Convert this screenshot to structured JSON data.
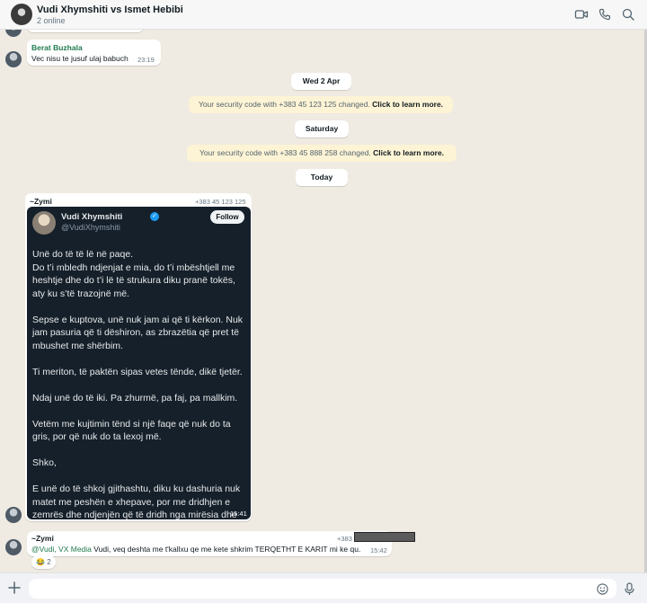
{
  "header": {
    "title": "Vudi Xhymshiti vs Ismet Hebibi",
    "subtitle": "2 online",
    "icons": [
      "video-call-icon",
      "voice-call-icon",
      "search-icon"
    ]
  },
  "messages": {
    "m1": {
      "sender": "Berat Buzhala",
      "sender_color": "#1f7a4d",
      "text": "Vec nisu te jusuf ulaj babuch",
      "time": "23:19"
    },
    "dates": {
      "d1": "Wed 2 Apr",
      "d2": "Saturday",
      "d3": "Today"
    },
    "sys1": {
      "prefix": "Your security code with +383 45 123 125 changed.",
      "link": "Click to learn more."
    },
    "sys2": {
      "prefix": "Your security code with +383 45 888 258 changed.",
      "link": "Click to learn more."
    },
    "m2": {
      "sender": "~Zymi",
      "phone": "+383 45 123 125",
      "time": "15:41",
      "tweet": {
        "name": "Vudi Xhymshiti",
        "handle": "@VudiXhymshiti",
        "follow_label": "Follow",
        "paragraphs": [
          "Unë do të të lë në paqe.\nDo t’i mbledh ndjenjat e mia, do t’i mbështjell me heshtje dhe do t’i lë të strukura diku pranë tokës, aty ku s’të trazojnë më.",
          "Sepse e kuptova, unë nuk jam ai që ti kërkon. Nuk jam pasuria që ti dëshiron, as zbrazëtia që pret të mbushet me shërbim.",
          "Ti meriton, të paktën sipas vetes tënde, dikë tjetër.",
          "Ndaj unë do të iki. Pa zhurmë, pa faj, pa mallkim.",
          "Vetëm me kujtimin tënd si një faqe që nuk do ta gris, por që nuk do ta lexoj më.",
          "Shko,",
          "E unë do të shkoj gjithashtu, diku ku dashuria nuk matet me peshën e xhepave, por me dridhjen e zemrës dhe ndjenjën që të dridh nga mirësia dhe"
        ]
      }
    },
    "m3": {
      "sender": "~Zymi",
      "phone": "+383",
      "mention": "@Vudi, VX Media",
      "text": "Vudi, veq deshta me t'kallxu qe me kete shkrim TERQETHT E KARIT mi ke qu.",
      "time": "15:42",
      "reaction_emoji": "😂",
      "reaction_count": "2"
    }
  },
  "composer": {
    "placeholder": "",
    "icons": [
      "plus-icon",
      "emoji-icon",
      "microphone-icon"
    ]
  },
  "colors": {
    "background": "#efeae2",
    "system_bg": "#fdf3d5",
    "mention": "#1f7a4d",
    "tweet_bg": "#15202b"
  }
}
